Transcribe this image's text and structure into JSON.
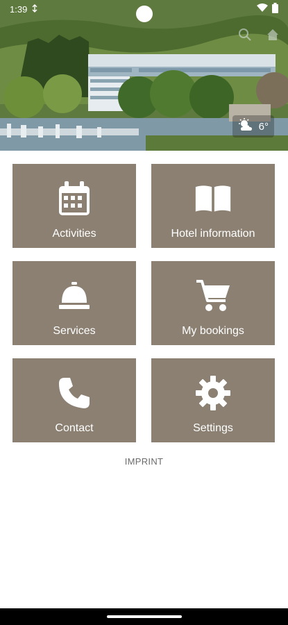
{
  "status_bar": {
    "time": "1:39",
    "notification_icon": "sync-icon",
    "wifi_icon": "wifi-icon",
    "battery_icon": "battery-icon"
  },
  "hero": {
    "image": "hotel-lakeside-photo",
    "temperature": "6°",
    "weather_icon": "sun-cloud-icon",
    "overlay_icons": [
      "search-icon",
      "home-icon"
    ]
  },
  "tiles": [
    {
      "label": "Activities",
      "icon": "calendar-icon"
    },
    {
      "label": "Hotel information",
      "icon": "book-icon"
    },
    {
      "label": "Services",
      "icon": "service-bell-icon"
    },
    {
      "label": "My bookings",
      "icon": "cart-icon"
    },
    {
      "label": "Contact",
      "icon": "phone-icon"
    },
    {
      "label": "Settings",
      "icon": "gear-icon"
    }
  ],
  "footer": {
    "imprint": "IMPRINT"
  },
  "colors": {
    "tile_background": "#8b8072",
    "tile_text": "#ffffff",
    "imprint_text": "#6b6b6b"
  }
}
